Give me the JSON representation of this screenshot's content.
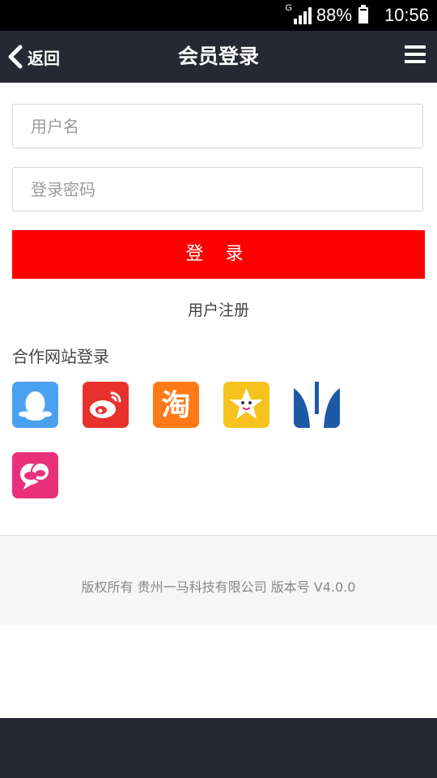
{
  "status_bar": {
    "network": "G",
    "battery": "88%",
    "time": "10:56"
  },
  "header": {
    "back_label": "返回",
    "title": "会员登录"
  },
  "form": {
    "username_placeholder": "用户名",
    "password_placeholder": "登录密码",
    "login_label": "登 录",
    "register_label": "用户注册"
  },
  "partners": {
    "title": "合作网站登录",
    "items": [
      {
        "name": "qq",
        "icon": "qq-icon",
        "color": "#4aa1f0"
      },
      {
        "name": "weibo",
        "icon": "weibo-icon",
        "color": "#e8312c"
      },
      {
        "name": "taobao",
        "icon": "taobao-icon",
        "color": "#ff7a17"
      },
      {
        "name": "star",
        "icon": "star-icon",
        "color": "#f6c21e"
      },
      {
        "name": "renren",
        "icon": "renren-icon",
        "color": "#1d5aa6"
      },
      {
        "name": "chat",
        "icon": "chat-icon",
        "color": "#e8307b"
      }
    ]
  },
  "footer": {
    "copyright": "版权所有 贵州一马科技有限公司 版本号 V4.0.0"
  },
  "colors": {
    "header_bg": "#262833",
    "accent": "#fe0000"
  }
}
